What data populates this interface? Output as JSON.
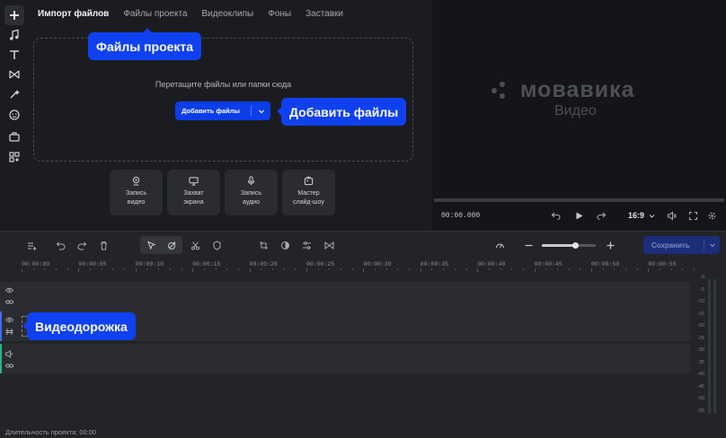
{
  "sidebar": {
    "items": [
      "add",
      "music",
      "text",
      "transitions",
      "effects",
      "stickers",
      "elements",
      "more"
    ]
  },
  "import": {
    "tabs": [
      {
        "label": "Импорт файлов",
        "active": true
      },
      {
        "label": "Файлы проекта",
        "active": false
      },
      {
        "label": "Видеоклипы",
        "active": false
      },
      {
        "label": "Фоны",
        "active": false
      },
      {
        "label": "Заставки",
        "active": false
      }
    ],
    "drop_text": "Перетащите файлы или папки сюда",
    "add_button": "Добавить файлы",
    "cards": [
      {
        "label": "Запись\nвидео",
        "icon": "webcam-icon"
      },
      {
        "label": "Захват\nэкрана",
        "icon": "monitor-icon"
      },
      {
        "label": "Запись\nаудио",
        "icon": "microphone-icon"
      },
      {
        "label": "Мастер\nслайд-шоу",
        "icon": "slideshow-icon"
      }
    ]
  },
  "preview": {
    "logo_text": "мовавика",
    "logo_sub": "Видео",
    "time": "00:00.000",
    "ratio": "16:9"
  },
  "timeline": {
    "save_label": "Сохранить",
    "zoom_level": 0.62,
    "ruler": [
      "00:00:00",
      "00:00:05",
      "00:00:10",
      "00:00:15",
      "00:00:20",
      "00:00:25",
      "00:00:30",
      "00:00:35",
      "00:00:40",
      "00:00:45",
      "00:00:50",
      "00:00:55"
    ],
    "meter_labels": [
      "0",
      "-5",
      "-10",
      "-15",
      "-20",
      "-25",
      "-30",
      "-35",
      "-40",
      "-45",
      "-50",
      "-55"
    ],
    "status": "Длительность проекта: 00:00"
  },
  "tooltips": {
    "files": "Файлы проекта",
    "add": "Добавить файлы",
    "track": "Видеодорожка"
  },
  "colors": {
    "accent": "#1041f0",
    "background": "#1b1c20",
    "preview_bg": "#141518",
    "audio_track_accent": "#2bb38a",
    "video_track_accent": "#3d6cf0"
  }
}
